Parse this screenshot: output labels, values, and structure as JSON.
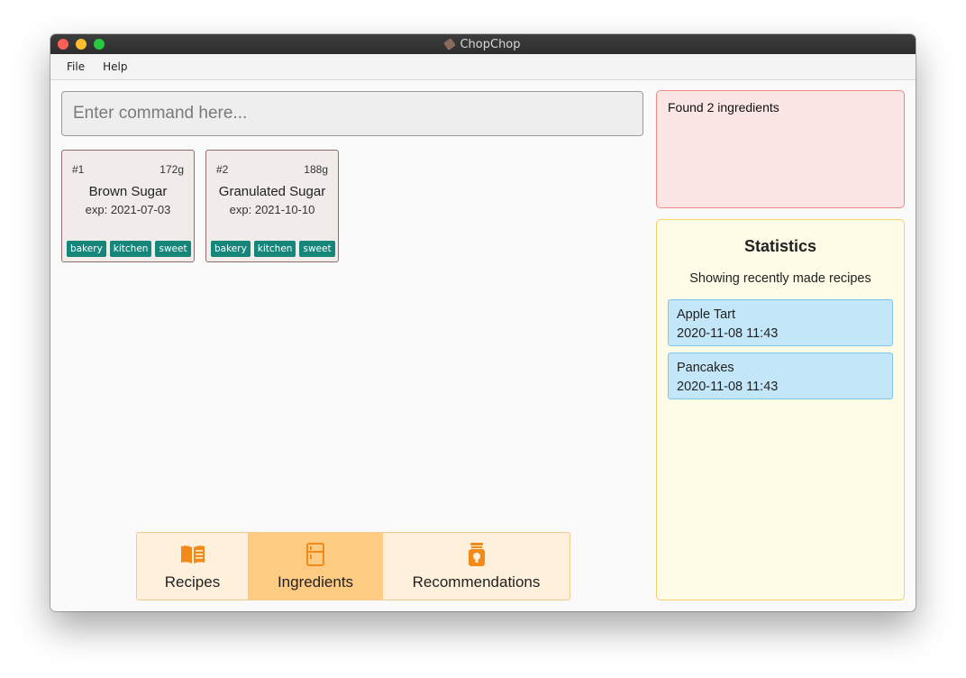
{
  "window": {
    "title": "ChopChop"
  },
  "menu": {
    "items": [
      "File",
      "Help"
    ]
  },
  "command": {
    "placeholder": "Enter command here..."
  },
  "ingredients": [
    {
      "index": "#1",
      "quantity": "172g",
      "name": "Brown Sugar",
      "expiry": "exp: 2021-07-03",
      "tags": [
        "bakery",
        "kitchen",
        "sweet"
      ]
    },
    {
      "index": "#2",
      "quantity": "188g",
      "name": "Granulated Sugar",
      "expiry": "exp: 2021-10-10",
      "tags": [
        "bakery",
        "kitchen",
        "sweet"
      ]
    }
  ],
  "result": {
    "message": "Found 2 ingredients"
  },
  "statistics": {
    "title": "Statistics",
    "subtitle": "Showing recently made recipes",
    "recipes": [
      {
        "name": "Apple Tart",
        "time": "2020-11-08 11:43"
      },
      {
        "name": "Pancakes",
        "time": "2020-11-08 11:43"
      }
    ]
  },
  "tabs": [
    {
      "label": "Recipes",
      "icon": "book-icon",
      "active": false
    },
    {
      "label": "Ingredients",
      "icon": "fridge-icon",
      "active": true
    },
    {
      "label": "Recommendations",
      "icon": "lightbulb-jar-icon",
      "active": false
    }
  ],
  "colors": {
    "accent": "#f28a1a",
    "tag": "#16857a",
    "result_bg": "#fbe6e5",
    "stats_bg": "#fefbe6",
    "recipe_bg": "#c3e7f8",
    "tab_active": "#fecb82"
  }
}
